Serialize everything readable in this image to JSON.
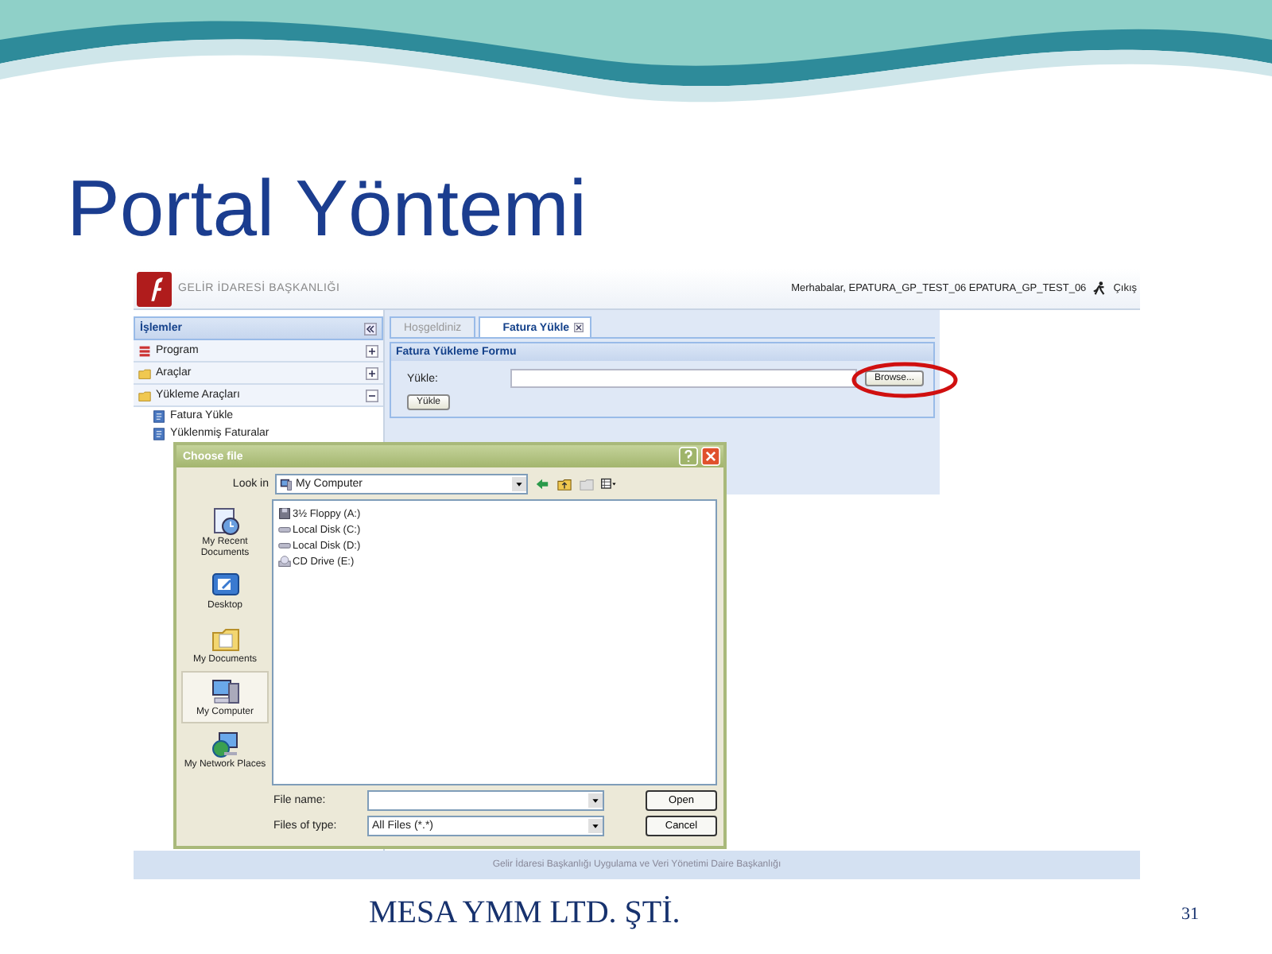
{
  "slide": {
    "title": "Portal Yöntemi",
    "company": "MESA YMM LTD. ŞTİ.",
    "page_number": "31"
  },
  "app": {
    "brand": "GELİR İDARESİ BAŞKANLIĞI",
    "greeting": "Merhabalar, EPATURA_GP_TEST_06 EPATURA_GP_TEST_06",
    "logout": "Çıkış",
    "sidebar": {
      "title": "İşlemler",
      "sections": [
        {
          "label": "Program",
          "kind": "program",
          "expanded": false
        },
        {
          "label": "Araçlar",
          "kind": "folder",
          "expanded": false
        },
        {
          "label": "Yükleme Araçları",
          "kind": "folder",
          "expanded": true,
          "children": [
            {
              "label": "Fatura Yükle"
            },
            {
              "label": "Yüklenmiş Faturalar"
            }
          ]
        }
      ]
    },
    "tabs": [
      {
        "label": "Hoşgeldiniz",
        "selected": false
      },
      {
        "label": "Fatura Yükle",
        "selected": true
      }
    ],
    "form": {
      "title": "Fatura Yükleme Formu",
      "field_label": "Yükle:",
      "browse_button": "Browse...",
      "submit_button": "Yükle"
    },
    "footer": "Gelir İdaresi Başkanlığı Uygulama ve Veri Yönetimi Daire Başkanlığı"
  },
  "dialog": {
    "title": "Choose file",
    "look_in_label": "Look in",
    "look_in": "My Computer",
    "places": [
      {
        "label": "My Recent Documents",
        "kind": "recent",
        "selected": false
      },
      {
        "label": "Desktop",
        "kind": "desktop",
        "selected": false
      },
      {
        "label": "My Documents",
        "kind": "documents",
        "selected": false
      },
      {
        "label": "My Computer",
        "kind": "computer",
        "selected": true
      },
      {
        "label": "My Network Places",
        "kind": "network",
        "selected": false
      }
    ],
    "files": [
      {
        "label": "3½ Floppy (A:)",
        "kind": "floppy"
      },
      {
        "label": "Local Disk (C:)",
        "kind": "disk"
      },
      {
        "label": "Local Disk (D:)",
        "kind": "disk"
      },
      {
        "label": "CD Drive (E:)",
        "kind": "cd"
      }
    ],
    "file_name_label": "File name:",
    "file_type_label": "Files of type:",
    "file_type": "All Files (*.*)",
    "buttons": [
      "Open",
      "Cancel"
    ]
  }
}
